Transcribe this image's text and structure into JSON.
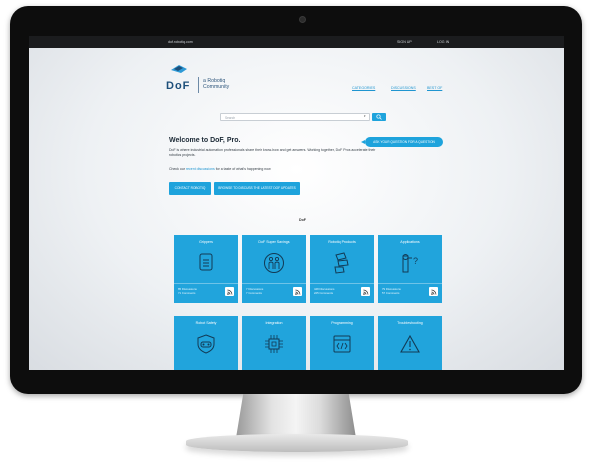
{
  "topbar": {
    "url_text": "dof.robotiq.com",
    "signup_label": "SIGN UP",
    "login_label": "LOG IN"
  },
  "logo": {
    "wordmark": "DoF",
    "tagline": "a Robotiq Community"
  },
  "nav": [
    {
      "label": "CATEGORIES"
    },
    {
      "label": "DISCUSSIONS"
    },
    {
      "label": "BEST OF"
    }
  ],
  "search": {
    "placeholder": "Search",
    "dropdown_glyph": "▾"
  },
  "welcome": {
    "title": "Welcome to DoF, Pro.",
    "body": "DoF is where industrial automation professionals share their know-how and get answers. Working together, DoF Pros accelerate their robotics projects.",
    "check_prefix": "Check our ",
    "check_link": "recent discussions",
    "check_suffix": " for a taste of what's happening now"
  },
  "buttons": {
    "contact": "CONTACT ROBOTIQ",
    "recommend": "BROWSE TO DISCUSS THE LATEST DOF UPDATES"
  },
  "ask_button": "ASK YOUR QUESTION FOR A QUESTION",
  "section_label": "DoF",
  "tiles": [
    {
      "title": "Grippers",
      "icon": "gripper-doc-icon",
      "line1": "85 Discussions",
      "line2": "71 Comments"
    },
    {
      "title": "DoF Super Savings",
      "icon": "people-icon",
      "line1": "7 Discussions",
      "line2": "7 Comments"
    },
    {
      "title": "Robotiq Products",
      "icon": "product-stack-icon",
      "line1": "448 Discussions",
      "line2": "225 Comments"
    },
    {
      "title": "Applications",
      "icon": "robot-arm-question-icon",
      "line1": "79 Discussions",
      "line2": "57 Comments"
    },
    {
      "title": "Robot Safety",
      "icon": "safety-shield-icon"
    },
    {
      "title": "Integration",
      "icon": "chip-icon"
    },
    {
      "title": "Programming",
      "icon": "code-window-icon"
    },
    {
      "title": "Troubleshooting",
      "icon": "warning-triangle-icon"
    }
  ],
  "colors": {
    "accent": "#21a4dc",
    "bezel": "#0d0d0d",
    "topbar": "#1b1c1e",
    "logo_blue": "#1d4f7a"
  }
}
